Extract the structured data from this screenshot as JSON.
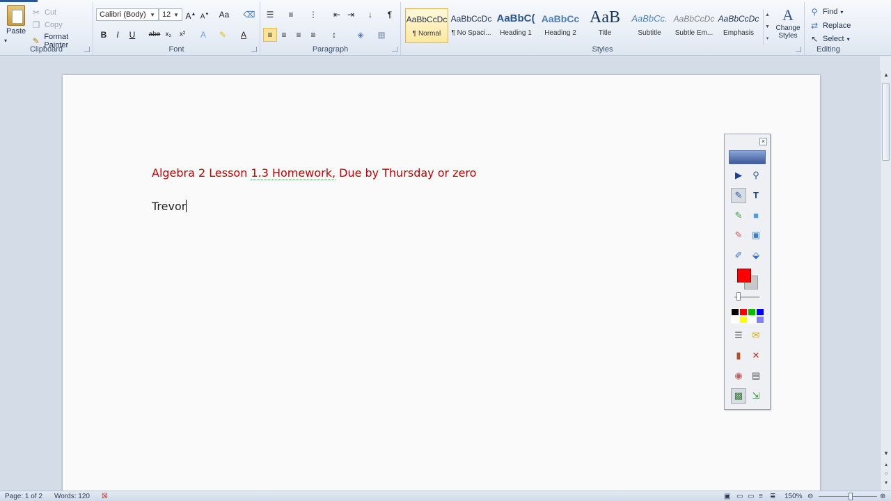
{
  "ribbon": {
    "clipboard": {
      "label": "Clipboard",
      "paste": "Paste",
      "cut": "Cut",
      "copy": "Copy",
      "format_painter": "Format Painter"
    },
    "font": {
      "label": "Font",
      "family": "Calibri (Body)",
      "size": "12",
      "grow": "A",
      "change_case": "Aa",
      "bold": "B",
      "italic": "I",
      "underline": "U",
      "strikethrough": "abe",
      "subscript": "x₂",
      "superscript": "x²"
    },
    "paragraph": {
      "label": "Paragraph",
      "pilcrow": "¶"
    },
    "styles": {
      "label": "Styles",
      "items": [
        {
          "sample": "AaBbCcDc",
          "name": "¶ Normal"
        },
        {
          "sample": "AaBbCcDc",
          "name": "¶ No Spaci..."
        },
        {
          "sample": "AaBbC(",
          "name": "Heading 1"
        },
        {
          "sample": "AaBbCc",
          "name": "Heading 2"
        },
        {
          "sample": "AaB",
          "name": "Title"
        },
        {
          "sample": "AaBbCc.",
          "name": "Subtitle"
        },
        {
          "sample": "AaBbCcDc",
          "name": "Subtle Em..."
        },
        {
          "sample": "AaBbCcDc",
          "name": "Emphasis"
        }
      ],
      "change_styles": "Change Styles"
    },
    "editing": {
      "label": "Editing",
      "find": "Find",
      "replace": "Replace",
      "select": "Select"
    }
  },
  "document": {
    "heading_before": "Algebra 2 Lesson ",
    "heading_spell": "1.3 Homework,",
    "heading_after": " Due by Thursday or zero",
    "heading_color": "#c00000",
    "name": "Trevor"
  },
  "status": {
    "page": "Page: 1 of 2",
    "words": "Words: 120",
    "zoom": "150%",
    "zoom_level": 0.5
  },
  "ink_toolbar": {
    "current_color": "#ff0000",
    "palette": [
      "#000000",
      "#ff0000",
      "#00c000",
      "#0000ff",
      "#ffffff",
      "#ffff00",
      "#ffffff",
      "#8080ff"
    ]
  },
  "icons": [
    "paste-icon",
    "cut-icon",
    "copy-icon",
    "format-painter-icon",
    "find-icon",
    "replace-icon",
    "select-icon",
    "pointer-icon",
    "zoom-icon",
    "pen-icon",
    "text-icon",
    "highlighter-icon",
    "shape-icon",
    "eraser-icon",
    "image-icon",
    "dropper-icon",
    "fill-icon",
    "close-icon"
  ]
}
